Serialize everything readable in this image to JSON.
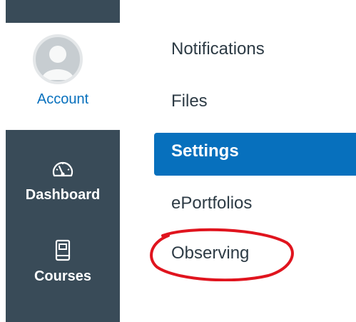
{
  "sidebar": {
    "account_label": "Account",
    "items": [
      {
        "label": "Dashboard",
        "icon": "dashboard-gauge-icon"
      },
      {
        "label": "Courses",
        "icon": "book-icon"
      }
    ]
  },
  "account_menu": {
    "items": [
      {
        "label": "Notifications",
        "active": false
      },
      {
        "label": "Files",
        "active": false
      },
      {
        "label": "Settings",
        "active": true
      },
      {
        "label": "ePortfolios",
        "active": false
      },
      {
        "label": "Observing",
        "active": false,
        "highlighted": true
      }
    ]
  },
  "colors": {
    "sidebar_bg": "#394b58",
    "active_bg": "#0770bd",
    "link": "#0770bd",
    "text": "#2d3b45",
    "annotation": "#e0141e"
  }
}
